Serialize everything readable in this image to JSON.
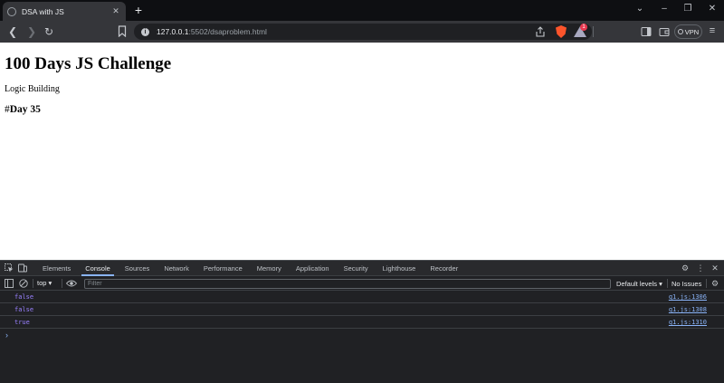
{
  "browser": {
    "tab": {
      "title": "DSA with JS",
      "icon": "globe-icon"
    },
    "new_tab_label": "+",
    "url": {
      "host": "127.0.0.1",
      "path": ":5502/dsaproblem.html"
    },
    "vpn_label": "VPN",
    "rewards_badge": "1"
  },
  "page": {
    "heading": "100 Days JS Challenge",
    "subtitle": "Logic Building",
    "day_prefix": "#",
    "day_label": "Day 35"
  },
  "devtools": {
    "tabs": [
      "Elements",
      "Console",
      "Sources",
      "Network",
      "Performance",
      "Memory",
      "Application",
      "Security",
      "Lighthouse",
      "Recorder"
    ],
    "active_tab": "Console",
    "context": "top",
    "filter_placeholder": "Filter",
    "levels": "Default levels",
    "issues": "No Issues",
    "logs": [
      {
        "value": "false",
        "source": "q1.js:1306"
      },
      {
        "value": "false",
        "source": "q1.js:1308"
      },
      {
        "value": "true",
        "source": "q1.js:1310"
      }
    ],
    "prompt": "›"
  },
  "colors": {
    "accent": "#8ab4f8",
    "boolean": "#9980ff",
    "brave": "#fb542b"
  }
}
